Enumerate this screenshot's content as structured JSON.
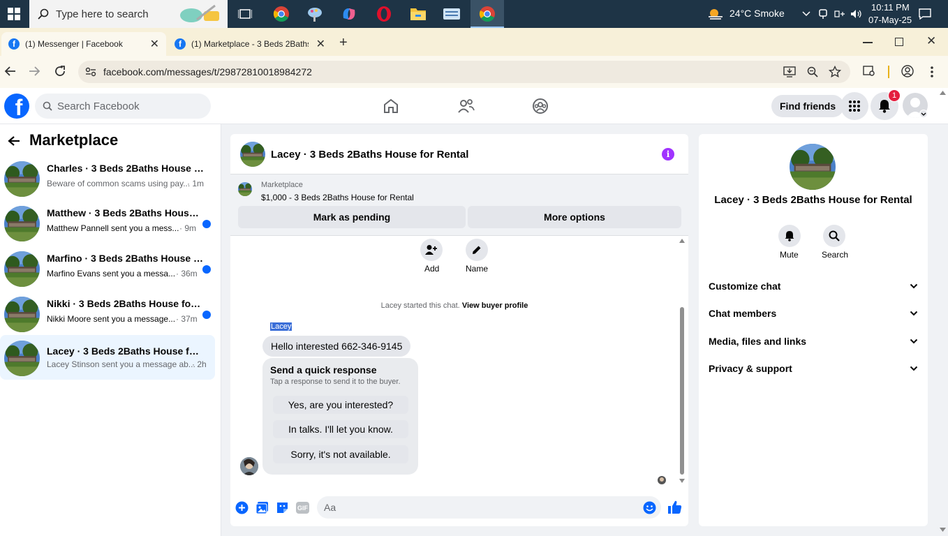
{
  "taskbar": {
    "search_placeholder": "Type here to search",
    "weather": "24°C  Smoke",
    "time": "10:11 PM",
    "date": "07-May-25"
  },
  "browser": {
    "tabs": [
      {
        "label": "(1) Messenger | Facebook",
        "active": true
      },
      {
        "label": "(1) Marketplace - 3 Beds 2Baths",
        "active": false
      }
    ],
    "url": "facebook.com/messages/t/29872810018984272"
  },
  "fb_header": {
    "search_placeholder": "Search Facebook",
    "find_friends": "Find friends",
    "notification_count": "1"
  },
  "left_panel": {
    "title": "Marketplace",
    "conversations": [
      {
        "name": "Charles · 3 Beds 2Baths House for Rental",
        "preview": "Beware of common scams using pay...",
        "time": "· 1m",
        "unread": false,
        "selected": false
      },
      {
        "name": "Matthew · 3 Beds 2Baths House for Rental",
        "preview": "Matthew Pannell sent you a mess...",
        "time": "· 9m",
        "unread": true,
        "selected": false
      },
      {
        "name": "Marfino · 3 Beds 2Baths House for Rental",
        "preview": "Marfino Evans sent you a messa...",
        "time": "· 36m",
        "unread": true,
        "selected": false
      },
      {
        "name": "Nikki · 3 Beds 2Baths House for Rental",
        "preview": "Nikki Moore sent you a message...",
        "time": "· 37m",
        "unread": true,
        "selected": false
      },
      {
        "name": "Lacey · 3 Beds 2Baths House for Rental",
        "preview": "Lacey Stinson sent you a message ab...",
        "time": "· 2h",
        "unread": false,
        "selected": true
      }
    ]
  },
  "chat": {
    "title": "Lacey · 3 Beds 2Baths House for Rental",
    "marketplace_label": "Marketplace",
    "listing": "$1,000 - 3 Beds 2Baths House for Rental",
    "mark_pending": "Mark as pending",
    "more_options": "More options",
    "add_label": "Add",
    "name_label": "Name",
    "started_text": "Lacey started this chat.",
    "view_buyer": "View buyer profile",
    "sender_name": "Lacey",
    "message": "Hello interested 662-346-9145",
    "quick_title": "Send a quick response",
    "quick_sub": "Tap a response to send it to the buyer.",
    "quick_responses": [
      "Yes, are you interested?",
      "In talks. I'll let you know.",
      "Sorry, it's not available."
    ],
    "composer_placeholder": "Aa"
  },
  "right_panel": {
    "title": "Lacey · 3 Beds 2Baths House for Rental",
    "mute": "Mute",
    "search": "Search",
    "sections": [
      "Customize chat",
      "Chat members",
      "Media, files and links",
      "Privacy & support"
    ]
  },
  "colors": {
    "fb_blue": "#0866ff",
    "messenger_purple": "#a033ff",
    "taskbar": "#1e3446"
  },
  "icons": [
    "windows-icon",
    "search-icon",
    "home-icon",
    "friends-icon",
    "groups-icon",
    "grid-icon",
    "bell-icon",
    "info-icon",
    "add-person-icon",
    "pencil-icon",
    "plus-circle-icon",
    "photo-icon",
    "sticker-icon",
    "gif-icon",
    "emoji-icon",
    "thumbs-up-icon",
    "chevron-down-icon"
  ]
}
